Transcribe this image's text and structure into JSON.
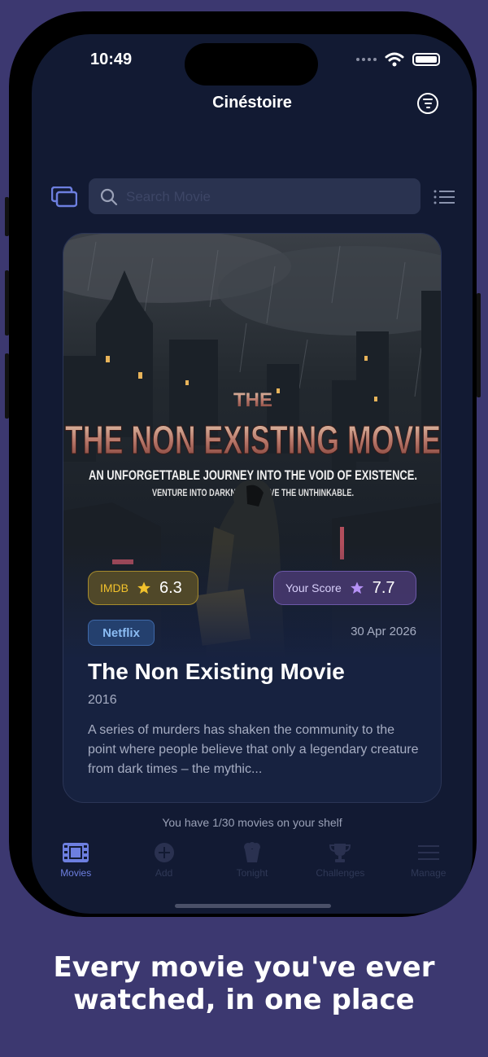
{
  "status": {
    "time": "10:49"
  },
  "header": {
    "title": "Cinéstoire",
    "filter_icon": "filter-icon"
  },
  "search": {
    "placeholder": "Search Movie"
  },
  "poster": {
    "small_title": "THE",
    "big_title": "THE NON EXISTING MOVIE",
    "tagline": "AN UNFORGETTABLE JOURNEY INTO THE VOID OF EXISTENCE.",
    "subtagline": "VENTURE INTO DARKNESS. SOLVE THE UNTHINKABLE."
  },
  "card": {
    "imdb_label": "IMDB",
    "imdb_score": "6.3",
    "your_score_label": "Your Score",
    "your_score": "7.7",
    "platform": "Netflix",
    "date": "30 Apr 2026",
    "title": "The Non Existing Movie",
    "year": "2016",
    "description": "A series of murders has shaken the community to the point where people believe that only a legendary creature from dark times – the mythic..."
  },
  "shelf_text": "You have 1/30 movies on your shelf",
  "tabs": [
    {
      "label": "Movies",
      "icon": "film-icon",
      "active": true
    },
    {
      "label": "Add",
      "icon": "plus-circle-icon",
      "active": false
    },
    {
      "label": "Tonight",
      "icon": "popcorn-icon",
      "active": false
    },
    {
      "label": "Challenges",
      "icon": "trophy-icon",
      "active": false
    },
    {
      "label": "Manage",
      "icon": "list-icon",
      "active": false
    }
  ],
  "colors": {
    "accent": "#6d7fe0",
    "background": "#3c3870",
    "screen": "#121a33",
    "imdb": "#f2c22c",
    "score": "#b591f5"
  },
  "headline": {
    "line1": "Every movie you've ever",
    "line2": "watched, in one place"
  }
}
